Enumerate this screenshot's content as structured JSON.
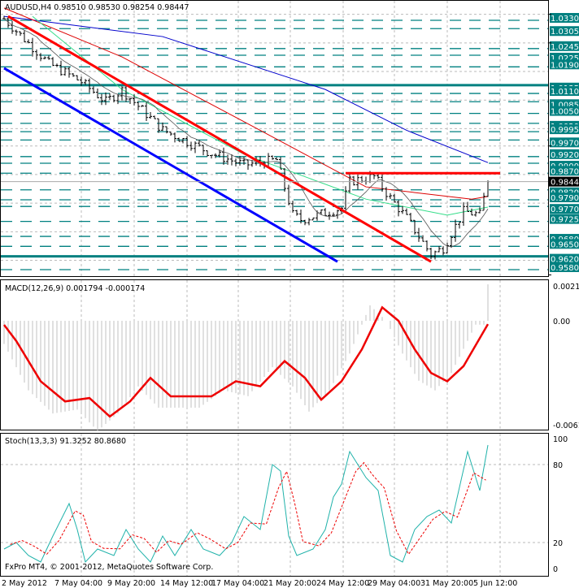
{
  "chart_data": [
    {
      "type": "line",
      "panel": "main",
      "title": "AUDUSD,H4 0.98510 0.98530 0.98254 0.98447",
      "symbol": "AUDUSD",
      "timeframe": "H4",
      "ohlc": {
        "open": 0.9851,
        "high": 0.9853,
        "low": 0.98254,
        "close": 0.98447
      },
      "current_price": "0.98447",
      "ylim": [
        0.9564,
        1.0348
      ],
      "axis_ticks": [
        "1.03480",
        "1.02620",
        "0.99520",
        "0.95640"
      ],
      "levels": [
        "1.03300",
        "1.03050",
        "1.02450",
        "1.02250",
        "1.01900",
        "1.01350",
        "1.01100",
        "1.00850",
        "1.00500",
        "1.00200",
        "0.99950",
        "0.99700",
        "0.99200",
        "0.99000",
        "0.98700",
        "0.98200",
        "0.97900",
        "0.97700",
        "0.97250",
        "0.96800",
        "0.96500",
        "0.96200",
        "0.95800"
      ],
      "solid_levels": [
        "1.01350",
        "0.96200"
      ],
      "price_path": [
        [
          0,
          1.0335
        ],
        [
          11,
          1.02
        ],
        [
          19,
          1.0145
        ],
        [
          25,
          1.0085
        ],
        [
          29,
          1.012
        ],
        [
          39,
          1.0
        ],
        [
          51,
          0.993
        ],
        [
          59,
          0.9895
        ],
        [
          67,
          0.991
        ],
        [
          71,
          0.9745
        ],
        [
          73,
          0.973
        ],
        [
          83,
          0.9765
        ],
        [
          85,
          0.9845
        ],
        [
          91,
          0.986
        ],
        [
          95,
          0.9795
        ],
        [
          99,
          0.9735
        ],
        [
          105,
          0.9625
        ],
        [
          108,
          0.9645
        ],
        [
          113,
          0.9755
        ],
        [
          117,
          0.9745
        ],
        [
          119,
          0.9845
        ]
      ],
      "moving_averages": [
        {
          "name": "MA blue",
          "color": "#0000cc",
          "points": [
            [
              0,
              1.0342
            ],
            [
              39,
              1.0281
            ],
            [
              79,
              1.0122
            ],
            [
              99,
              0.9999
            ],
            [
              119,
              0.9902
            ]
          ]
        },
        {
          "name": "MA red",
          "color": "#dd0000",
          "points": [
            [
              0,
              1.0367
            ],
            [
              29,
              1.022
            ],
            [
              59,
              1.0025
            ],
            [
              89,
              0.9829
            ],
            [
              115,
              0.9792
            ],
            [
              119,
              0.98
            ]
          ]
        },
        {
          "name": "MA green",
          "color": "#33dd88",
          "points": [
            [
              7,
              1.0342
            ],
            [
              29,
              1.0122
            ],
            [
              59,
              0.9927
            ],
            [
              89,
              0.9792
            ],
            [
              109,
              0.9744
            ],
            [
              119,
              0.9768
            ]
          ]
        }
      ],
      "trendlines": [
        {
          "color": "#ff0000",
          "points": [
            [
              1,
              1.0342
            ],
            [
              105,
              0.9604
            ]
          ]
        },
        {
          "color": "#0000ff",
          "points": [
            [
              0,
              1.0186
            ],
            [
              82,
              0.9604
            ]
          ]
        },
        {
          "color": "#ff0000",
          "points": [
            [
              84,
              0.987
            ],
            [
              122,
              0.987
            ]
          ]
        }
      ]
    },
    {
      "type": "bar",
      "panel": "macd",
      "title": "MACD(12,26,9) 0.001794 -0.000174",
      "ylim": [
        -0.0061,
        0.00217
      ],
      "axis_ticks": [
        "0.00217",
        "0.00",
        "-0.0061"
      ],
      "signal": [
        [
          0,
          -0.00024
        ],
        [
          3,
          -0.0012
        ],
        [
          9,
          -0.0036
        ],
        [
          15,
          -0.0048
        ],
        [
          21,
          -0.0046
        ],
        [
          26,
          -0.0057
        ],
        [
          31,
          -0.0048
        ],
        [
          36,
          -0.0034
        ],
        [
          41,
          -0.0045
        ],
        [
          51,
          -0.0045
        ],
        [
          57,
          -0.0036
        ],
        [
          63,
          -0.0039
        ],
        [
          69,
          -0.0024
        ],
        [
          74,
          -0.0034
        ],
        [
          78,
          -0.0047
        ],
        [
          83,
          -0.0036
        ],
        [
          88,
          -0.0017
        ],
        [
          93,
          0.0008
        ],
        [
          97,
          0.0
        ],
        [
          101,
          -0.0017
        ],
        [
          105,
          -0.0031
        ],
        [
          109,
          -0.0036
        ],
        [
          113,
          -0.0027
        ],
        [
          119,
          -0.0002
        ]
      ]
    },
    {
      "type": "line",
      "panel": "stochastic",
      "title": "Stoch(13,3,3) 91.3252 80.8680",
      "ylim": [
        0,
        100
      ],
      "axis_ticks": [
        "100",
        "80",
        "20",
        "0"
      ],
      "main": [
        [
          0,
          15
        ],
        [
          3,
          20
        ],
        [
          6,
          10
        ],
        [
          9,
          5
        ],
        [
          12,
          25
        ],
        [
          16,
          50
        ],
        [
          18,
          30
        ],
        [
          20,
          5
        ],
        [
          23,
          15
        ],
        [
          27,
          10
        ],
        [
          30,
          30
        ],
        [
          33,
          15
        ],
        [
          36,
          5
        ],
        [
          39,
          25
        ],
        [
          42,
          10
        ],
        [
          46,
          30
        ],
        [
          49,
          15
        ],
        [
          53,
          10
        ],
        [
          56,
          20
        ],
        [
          59,
          40
        ],
        [
          63,
          30
        ],
        [
          66,
          80
        ],
        [
          68,
          75
        ],
        [
          70,
          25
        ],
        [
          72,
          10
        ],
        [
          76,
          15
        ],
        [
          79,
          30
        ],
        [
          81,
          55
        ],
        [
          83,
          65
        ],
        [
          85,
          90
        ],
        [
          87,
          80
        ],
        [
          89,
          70
        ],
        [
          92,
          60
        ],
        [
          95,
          10
        ],
        [
          98,
          5
        ],
        [
          101,
          30
        ],
        [
          104,
          40
        ],
        [
          107,
          45
        ],
        [
          110,
          35
        ],
        [
          114,
          90
        ],
        [
          117,
          60
        ],
        [
          119,
          95
        ]
      ]
    }
  ],
  "time_axis": [
    "2 May 2012",
    "7 May 04:00",
    "9 May 20:00",
    "14 May 12:00",
    "17 May 04:00",
    "21 May 20:00",
    "24 May 12:00",
    "29 May 04:00",
    "31 May 20:00",
    "5 Jun 12:00"
  ],
  "footer": "FxPro MT4, © 2001-2012, MetaQuotes Software Corp."
}
